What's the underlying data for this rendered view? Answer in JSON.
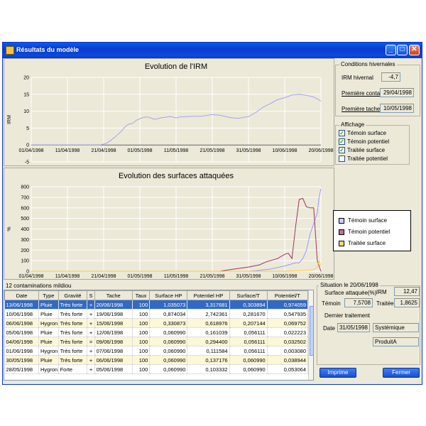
{
  "window": {
    "title": "Résultats du modèle"
  },
  "chart_data": [
    {
      "type": "line",
      "title": "Evolution de l'IRM",
      "ylabel": "IRM",
      "ylim": [
        -5,
        20
      ],
      "y_ticks": [
        "20",
        "15",
        "10",
        "5",
        "0",
        "-5"
      ],
      "x_ticks": [
        "01/04/1998",
        "11/04/1998",
        "21/04/1998",
        "01/05/1998",
        "11/05/1998",
        "21/05/1998",
        "31/05/1998",
        "10/06/1998",
        "20/06/1998"
      ],
      "grid": true,
      "series": [
        {
          "color": "#a4a2f3",
          "x": [
            0,
            10,
            19,
            21,
            23,
            25,
            26,
            27,
            28,
            29,
            30,
            31,
            32,
            33,
            34,
            35,
            36,
            37,
            38,
            39,
            40,
            41,
            43,
            45,
            47,
            50,
            52,
            55,
            57,
            60,
            62,
            64,
            66,
            68,
            70,
            72,
            74,
            76,
            78,
            80
          ],
          "y": [
            0,
            0,
            0,
            0.6,
            2.2,
            4.2,
            5.5,
            6.2,
            6.4,
            7.3,
            7.8,
            8.2,
            8.3,
            8.0,
            7.6,
            7.8,
            8.1,
            8.2,
            8.4,
            8.3,
            8.0,
            8.3,
            8.4,
            8.5,
            8.5,
            9.0,
            8.8,
            8.1,
            7.9,
            8.4,
            9.6,
            11.2,
            12.2,
            13.4,
            14.0,
            14.8,
            15.0,
            14.7,
            14.2,
            13.0
          ]
        }
      ]
    },
    {
      "type": "line",
      "title": "Evolution des surfaces attaquées",
      "ylabel": "%",
      "ylim": [
        0,
        800
      ],
      "y_ticks": [
        "800",
        "700",
        "600",
        "500",
        "400",
        "300",
        "200",
        "100",
        "0"
      ],
      "x_ticks": [
        "01/04/1998",
        "11/04/1998",
        "21/04/1998",
        "01/05/1998",
        "11/05/1998",
        "21/05/1998",
        "31/05/1998",
        "10/06/1998",
        "20/06/1998"
      ],
      "grid": true,
      "legend": "right",
      "series": [
        {
          "name": "Témoin surface",
          "color": "#9999ff",
          "x": [
            0,
            55,
            60,
            62,
            66,
            70,
            73,
            74,
            75,
            76,
            77,
            78,
            79,
            79.5,
            80
          ],
          "y": [
            0,
            0,
            0,
            5,
            20,
            50,
            80,
            80,
            120,
            200,
            350,
            450,
            550,
            700,
            780
          ]
        },
        {
          "name": "Témoin potentiel",
          "color": "#993366",
          "x": [
            0,
            52,
            56,
            60,
            63,
            65,
            68,
            70,
            71,
            72,
            73,
            74,
            75,
            76,
            77,
            78,
            79,
            80
          ],
          "y": [
            0,
            0,
            20,
            40,
            60,
            90,
            120,
            160,
            170,
            120,
            420,
            680,
            690,
            610,
            600,
            600,
            100,
            0
          ]
        },
        {
          "name": "Traitée surface",
          "color": "#ffcc33",
          "x": [
            0,
            70,
            75,
            78,
            79,
            79.5,
            80
          ],
          "y": [
            0,
            0,
            5,
            15,
            40,
            100,
            50
          ]
        }
      ]
    }
  ],
  "conditions": {
    "title": "Conditions hivernales",
    "irm_label": "IRM hivernal",
    "irm_value": "-4,7",
    "premiere_conta_label": "Première conta",
    "premiere_conta_value": "29/04/1998",
    "premiere_tache_label": "Première tache",
    "premiere_tache_value": "10/05/1998"
  },
  "affichage": {
    "title": "Affichage",
    "items": [
      {
        "label": "Témoin surface",
        "checked": true
      },
      {
        "label": "Témoin potentiel",
        "checked": true
      },
      {
        "label": "Traitée surface",
        "checked": true
      },
      {
        "label": "Traitée potentiel",
        "checked": false
      }
    ]
  },
  "table": {
    "caption": "12 contaminations mildiou",
    "columns": [
      "Date",
      "Type",
      "Gravité",
      "S",
      "Tache",
      "Taux",
      "Surface HP",
      "Potentiel HP",
      "Surface/T",
      "Potentiel/T"
    ],
    "rows": [
      [
        "13/06/1998",
        "Pluie",
        "Très forte",
        "+",
        "20/06/1998",
        "100",
        "1,035073",
        "3,317681",
        "0,303894",
        "0,974059"
      ],
      [
        "10/06/1998",
        "Pluie",
        "Très forte",
        "+",
        "19/06/1998",
        "100",
        "0,874034",
        "2,742361",
        "0,281670",
        "0,547935"
      ],
      [
        "06/06/1998",
        "Hygron",
        "Très forte",
        "+",
        "15/06/1998",
        "100",
        "0,330873",
        "0,618976",
        "0,207144",
        "0,069752"
      ],
      [
        "05/06/1998",
        "Pluie",
        "Très forte",
        "+",
        "12/06/1998",
        "100",
        "0,060990",
        "0,161039",
        "0,056111",
        "0,022223"
      ],
      [
        "04/06/1998",
        "Pluie",
        "Très forte",
        "=",
        "09/06/1998",
        "100",
        "0,060990",
        "0,294400",
        "0,056111",
        "0,032502"
      ],
      [
        "01/06/1998",
        "Hygron",
        "Très forte",
        "+",
        "07/06/1998",
        "100",
        "0,060990",
        "0,111584",
        "0,056111",
        "0,003080"
      ],
      [
        "30/05/1998",
        "Pluie",
        "Très forte",
        "+",
        "06/06/1998",
        "100",
        "0,060990",
        "0,137176",
        "0,060990",
        "0,038944"
      ],
      [
        "28/05/1998",
        "Hygron",
        "Forte",
        "+",
        "05/06/1998",
        "100",
        "0,060990",
        "0,103332",
        "0,060990",
        "0,053064"
      ]
    ],
    "selected_row": 0
  },
  "situation": {
    "title": "Situation le 20/06/1998",
    "surface_label": "Surface attaquée(%)",
    "temoin_label": "Témoin",
    "temoin_value": "7,5708",
    "irm_label": "IRM",
    "irm_value": "12,47",
    "traitee_label": "Traitée",
    "traitee_value": "1,8625",
    "dernier_label": "Dernier traitement",
    "date_label": "Date",
    "date_value": "31/05/1998",
    "type_value": "Systémique",
    "produit_value": "ProduitA"
  },
  "buttons": {
    "imprime": "Imprime",
    "fermer": "Fermer"
  }
}
